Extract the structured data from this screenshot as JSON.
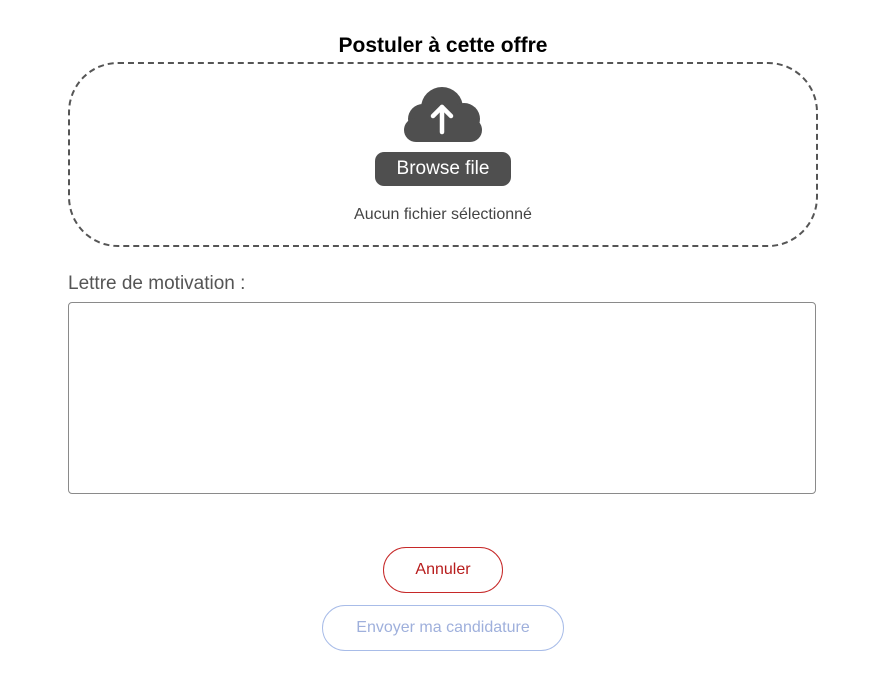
{
  "form": {
    "title": "Postuler à cette offre",
    "upload": {
      "icon": "cloud-upload-icon",
      "browse_label": "Browse file",
      "file_status": "Aucun fichier sélectionné"
    },
    "cover_letter": {
      "label": "Lettre de motivation :",
      "value": ""
    },
    "buttons": {
      "cancel_label": "Annuler",
      "submit_label": "Envoyer ma candidature"
    }
  },
  "colors": {
    "browse_button": "#4f4f4f",
    "cancel_accent": "#c62828",
    "submit_disabled": "#a8bce8",
    "dropzone_border": "#555555"
  }
}
